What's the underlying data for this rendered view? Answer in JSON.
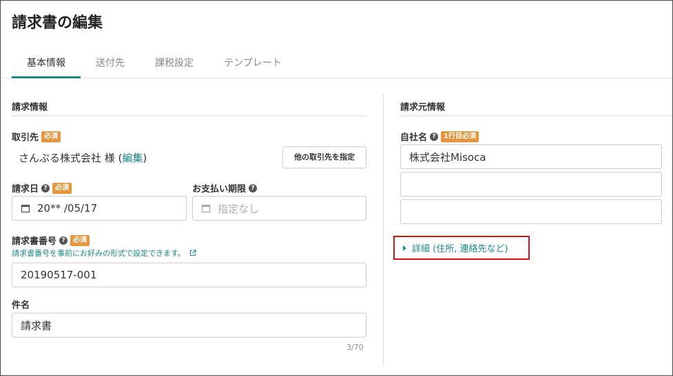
{
  "page": {
    "title": "請求書の編集"
  },
  "tabs": [
    {
      "label": "基本情報",
      "active": true
    },
    {
      "label": "送付先"
    },
    {
      "label": "課税設定"
    },
    {
      "label": "テンプレート"
    }
  ],
  "left_section": {
    "title": "請求情報",
    "client": {
      "label": "取引先",
      "required": "必須",
      "value": "さんぷる株式会社 様 (",
      "edit_link": "編集",
      "close_paren": ")",
      "select_button": "他の取引先を指定"
    },
    "invoice_date": {
      "label": "請求日",
      "required": "必須",
      "value": "20** /05/17"
    },
    "due_date": {
      "label": "お支払い期限",
      "placeholder": "指定なし"
    },
    "invoice_number": {
      "label": "請求書番号",
      "required": "必須",
      "hint": "請求書番号を事前にお好みの形式で設定できます。",
      "value": "20190517-001"
    },
    "subject": {
      "label": "件名",
      "value": "請求書",
      "counter": "3/70"
    }
  },
  "right_section": {
    "title": "請求元情報",
    "company_name": {
      "label": "自社名",
      "required": "1行目必須",
      "line1": "株式会社Misoca",
      "line2": "",
      "line3": ""
    },
    "details_toggle": "詳細 (住所, 連絡先など)"
  },
  "colors": {
    "accent": "#1a8a8a",
    "badge": "#e8943a",
    "highlight_border": "#dd1111"
  }
}
